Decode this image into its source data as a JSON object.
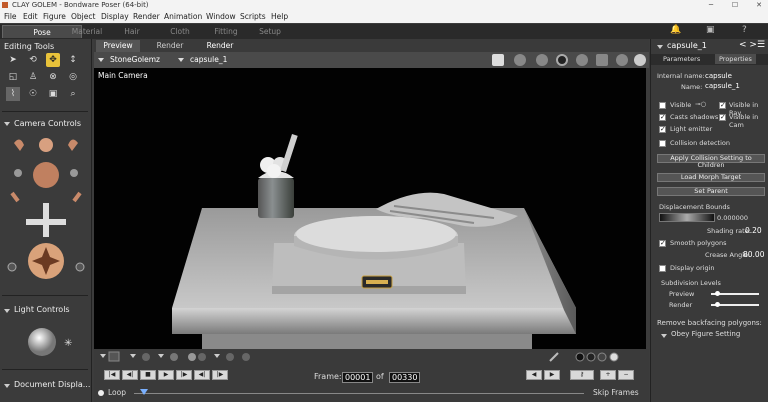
{
  "window": {
    "title": "CLAY GOLEM - Bondware Poser (64-bit)"
  },
  "menu": [
    "File",
    "Edit",
    "Figure",
    "Object",
    "Display",
    "Render",
    "Animation",
    "Window",
    "Scripts",
    "Help"
  ],
  "room_tabs": [
    "Pose",
    "Material",
    "Hair",
    "Cloth",
    "Fitting",
    "Setup"
  ],
  "left": {
    "editing_tools": "Editing Tools",
    "camera_controls": "Camera Controls",
    "light_controls": "Light Controls",
    "document_display": "Document Displa..."
  },
  "viewport": {
    "tabs": [
      "Preview",
      "Render",
      "Render"
    ],
    "figure_select": "StoneGolemz",
    "actor_select": "capsule_1",
    "camera_label": "Main Camera"
  },
  "animation": {
    "frame_label": "Frame:",
    "frame_current": "00001",
    "of_label": "of",
    "frame_total": "00330",
    "loop_label": "Loop",
    "skip_frames_label": "Skip Frames"
  },
  "right": {
    "actor": "capsule_1",
    "tabs": [
      "Parameters",
      "Properties"
    ],
    "internal_name_label": "Internal name:",
    "internal_name": "capsule",
    "name_label": "Name:",
    "name": "capsule_1",
    "visible": "Visible",
    "visible_in_ray": "Visible in Ray",
    "casts_shadows": "Casts shadows",
    "visible_in_cam": "Visible in Cam",
    "light_emitter": "Light emitter",
    "collision_detection": "Collision detection",
    "apply_collision": "Apply Collision Setting to Children",
    "load_morph": "Load Morph Target",
    "set_parent": "Set Parent",
    "displacement_bounds": "Displacement Bounds",
    "displacement_value": "0.000000",
    "shading_rate_label": "Shading rate:",
    "shading_rate": "0.20",
    "smooth_polygons": "Smooth polygons",
    "crease_angle_label": "Crease Angle:",
    "crease_angle": "80.00",
    "display_origin": "Display origin",
    "subdivision_levels": "Subdivision Levels",
    "preview": "Preview",
    "render": "Render",
    "remove_backfacing": "Remove backfacing polygons:",
    "obey_figure": "Obey Figure Setting"
  }
}
